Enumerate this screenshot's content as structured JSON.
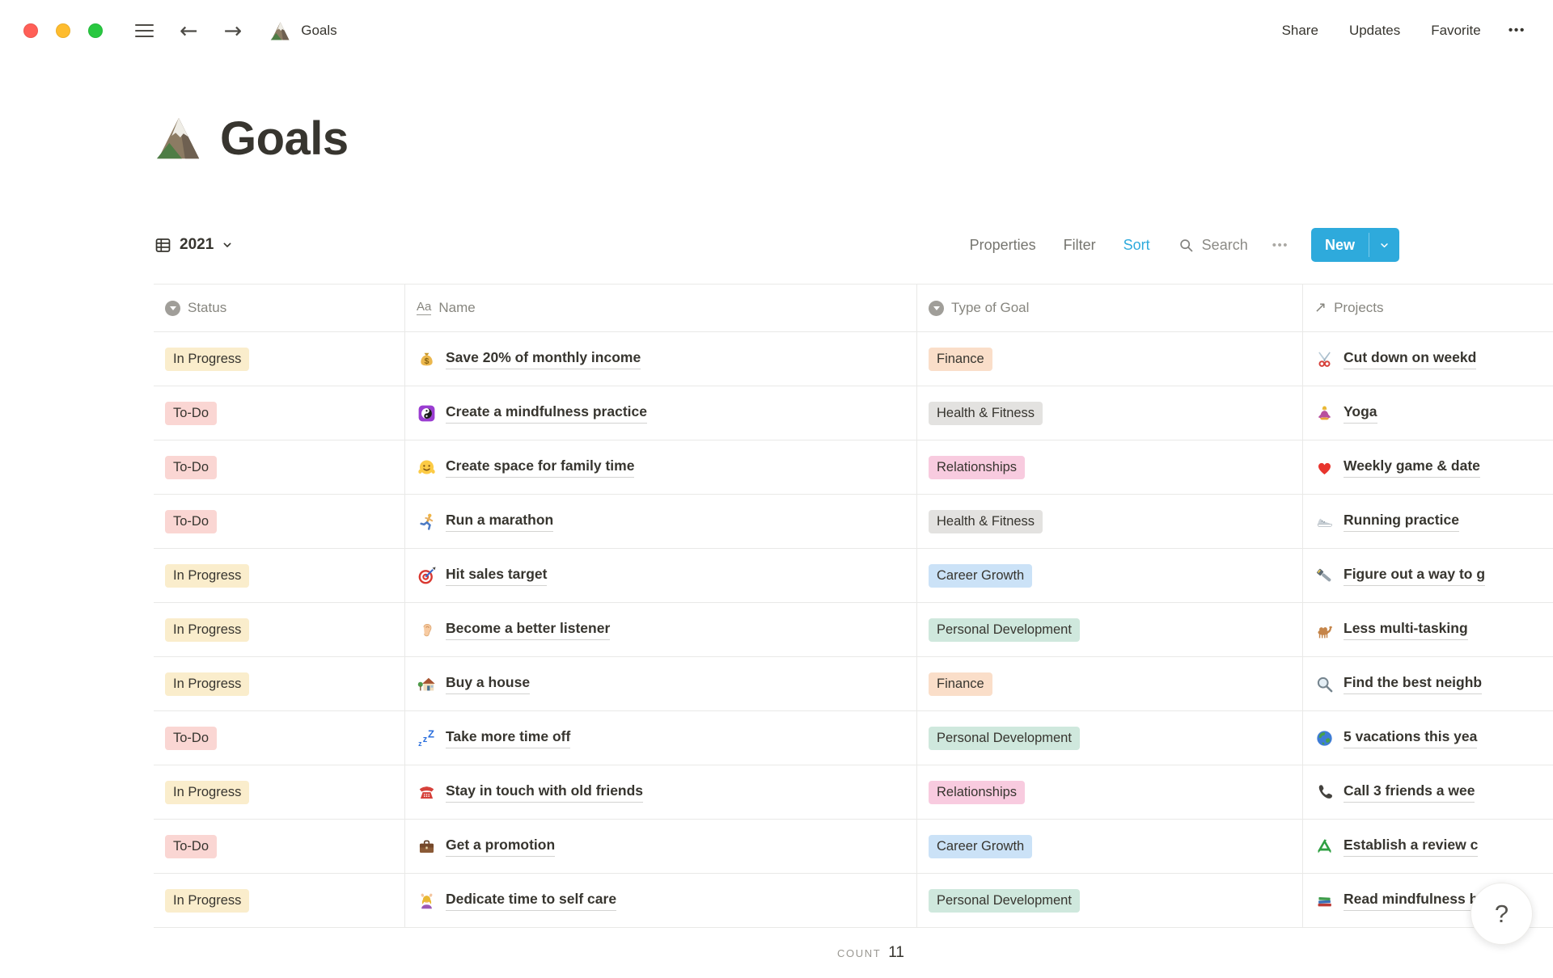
{
  "colors": {
    "accent_blue": "#2EAADC",
    "traffic_close": "#FF5F57",
    "traffic_minimize": "#FEBC2E",
    "traffic_zoom": "#28C840",
    "tag_text": "#37352F",
    "tags": {
      "In Progress": "#FAEDCC",
      "To-Do": "#FAD6D3",
      "Finance": "#FADEC9",
      "Health & Fitness": "#E3E2E0",
      "Relationships": "#F8CBDF",
      "Career Growth": "#CBE2F7",
      "Personal Development": "#CFE8DD"
    }
  },
  "topbar": {
    "back": "←",
    "forward": "→",
    "doc_icon": "mountain",
    "doc_title": "Goals",
    "menu_items": [
      "Share",
      "Updates",
      "Favorite"
    ],
    "more": "•••"
  },
  "page": {
    "icon": "mountain",
    "title": "Goals"
  },
  "toolbar": {
    "view_icon": "table",
    "view_name": "2021",
    "actions": [
      {
        "label": "Properties",
        "active": false
      },
      {
        "label": "Filter",
        "active": false
      },
      {
        "label": "Sort",
        "active": true
      }
    ],
    "search_label": "Search",
    "more": "•••",
    "new_label": "New"
  },
  "table": {
    "columns": [
      {
        "label": "Status",
        "icon": "select"
      },
      {
        "label": "Name",
        "icon": "title"
      },
      {
        "label": "Type of Goal",
        "icon": "select"
      },
      {
        "label": "Projects",
        "icon": "relation"
      }
    ],
    "rows": [
      {
        "status": "In Progress",
        "name_icon": "money-bag",
        "name": "Save 20% of monthly income",
        "type": "Finance",
        "project_icon": "scissors",
        "project": "Cut down on weekd"
      },
      {
        "status": "To-Do",
        "name_icon": "yin-yang",
        "name": "Create a mindfulness practice",
        "type": "Health & Fitness",
        "project_icon": "lotus",
        "project": "Yoga"
      },
      {
        "status": "To-Do",
        "name_icon": "hugging-face",
        "name": "Create space for family time",
        "type": "Relationships",
        "project_icon": "heart",
        "project": "Weekly game & date"
      },
      {
        "status": "To-Do",
        "name_icon": "runner",
        "name": "Run a marathon",
        "type": "Health & Fitness",
        "project_icon": "running-shoe",
        "project": "Running practice"
      },
      {
        "status": "In Progress",
        "name_icon": "dart-target",
        "name": "Hit sales target",
        "type": "Career Growth",
        "project_icon": "flashlight",
        "project": "Figure out a way to g"
      },
      {
        "status": "In Progress",
        "name_icon": "ear",
        "name": "Become a better listener",
        "type": "Personal Development",
        "project_icon": "camel",
        "project": "Less multi-tasking"
      },
      {
        "status": "In Progress",
        "name_icon": "house",
        "name": "Buy a house",
        "type": "Finance",
        "project_icon": "magnifier",
        "project": "Find the best neighb"
      },
      {
        "status": "To-Do",
        "name_icon": "zzz",
        "name": "Take more time off",
        "type": "Personal Development",
        "project_icon": "globe",
        "project": "5 vacations this yea"
      },
      {
        "status": "In Progress",
        "name_icon": "telephone",
        "name": "Stay in touch with old friends",
        "type": "Relationships",
        "project_icon": "phone-receiver",
        "project": "Call 3 friends a wee"
      },
      {
        "status": "To-Do",
        "name_icon": "briefcase",
        "name": "Get a promotion",
        "type": "Career Growth",
        "project_icon": "recycle",
        "project": "Establish a review c"
      },
      {
        "status": "In Progress",
        "name_icon": "massage",
        "name": "Dedicate time to self care",
        "type": "Personal Development",
        "project_icon": "books",
        "project": "Read mindfulness b"
      }
    ],
    "footer": {
      "aggregate_label": "COUNT",
      "aggregate_value": "11"
    }
  },
  "help_button": {
    "label": "?"
  }
}
